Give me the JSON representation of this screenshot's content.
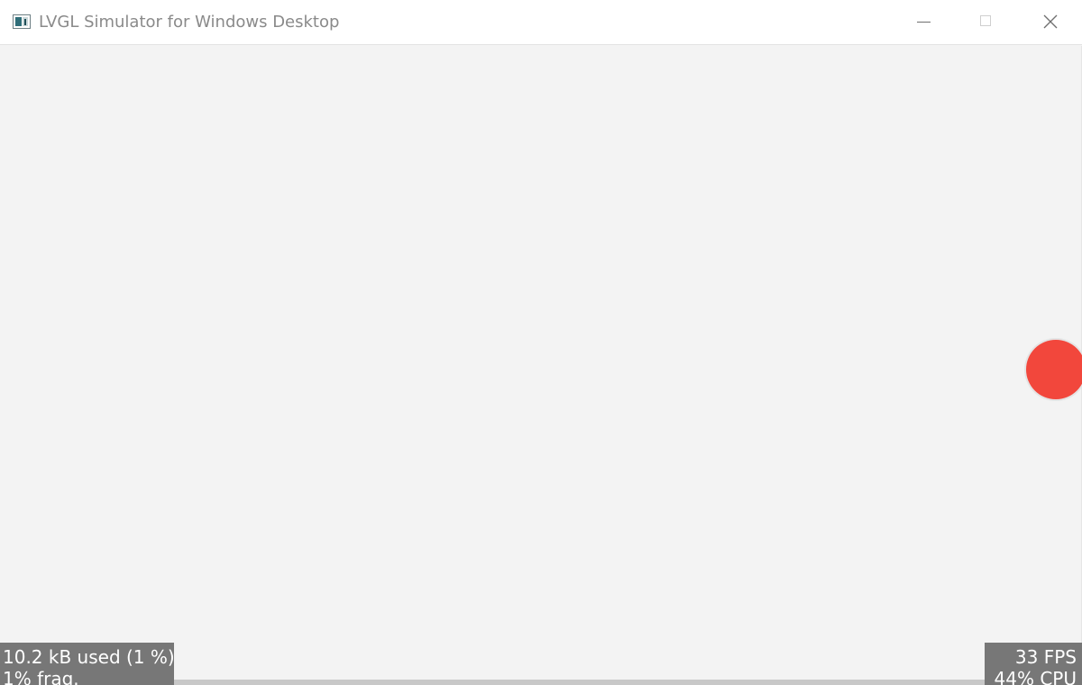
{
  "window": {
    "title": "LVGL Simulator for Windows Desktop",
    "icon": "lvgl-app-icon",
    "controls": {
      "minimize_icon": "minimize-icon",
      "maximize_icon": "maximize-icon",
      "close_icon": "close-icon"
    }
  },
  "canvas": {
    "background_color": "#f3f3f3",
    "knob_color": "#f2473c"
  },
  "mem_monitor": {
    "used": "10.2 kB used (1 %)",
    "frag": "1% frag."
  },
  "perf_monitor": {
    "fps": "33 FPS",
    "cpu": "44% CPU"
  }
}
